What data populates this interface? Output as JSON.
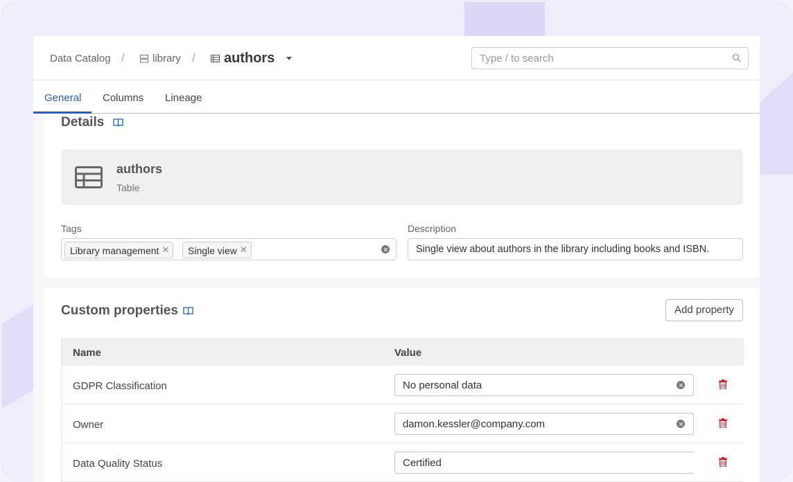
{
  "breadcrumb": {
    "root": "Data Catalog",
    "schema": "library",
    "current": "authors",
    "separator": "/"
  },
  "search": {
    "placeholder": "Type / to search"
  },
  "tabs": [
    {
      "label": "General",
      "active": true
    },
    {
      "label": "Columns",
      "active": false
    },
    {
      "label": "Lineage",
      "active": false
    }
  ],
  "details": {
    "title": "Details",
    "entity_name": "authors",
    "entity_type": "Table",
    "tags_label": "Tags",
    "tags": [
      "Library management",
      "Single view"
    ],
    "description_label": "Description",
    "description": "Single view about authors in the library including books and ISBN."
  },
  "custom_properties": {
    "title": "Custom properties",
    "add_button": "Add property",
    "columns": [
      "Name",
      "Value"
    ],
    "rows": [
      {
        "name": "GDPR Classification",
        "value": "No personal data"
      },
      {
        "name": "Owner",
        "value": "damon.kessler@company.com"
      },
      {
        "name": "Data Quality Status",
        "value": "Certified"
      }
    ]
  },
  "colors": {
    "accent": "#1d5fc9",
    "danger": "#c0283a",
    "frame": "#efecfb"
  }
}
